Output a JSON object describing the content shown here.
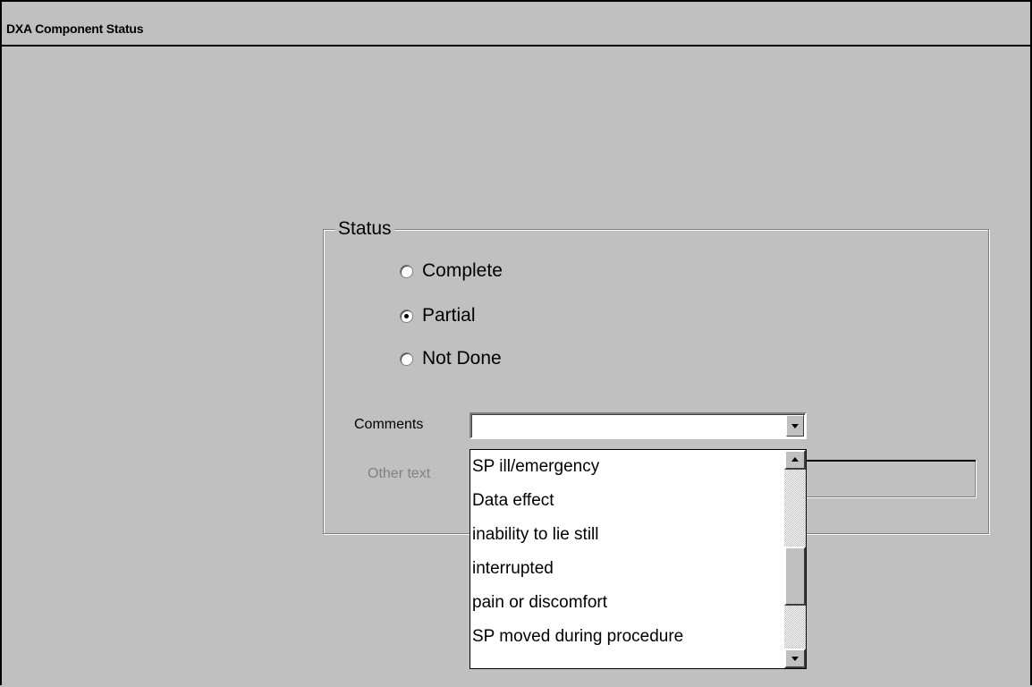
{
  "window": {
    "title": "DXA Component Status"
  },
  "status_group": {
    "legend": "Status",
    "options": [
      {
        "label": "Complete",
        "checked": false
      },
      {
        "label": "Partial",
        "checked": true
      },
      {
        "label": "Not Done",
        "checked": false
      }
    ]
  },
  "comments": {
    "label": "Comments",
    "value": "",
    "items": [
      "SP ill/emergency",
      "Data effect",
      "inability to lie still",
      "interrupted",
      "pain or discomfort",
      "SP moved during procedure"
    ]
  },
  "other_text": {
    "label": "Other text",
    "value": ""
  },
  "colors": {
    "background": "#c0c0c0",
    "list_background": "#ffffff",
    "disabled_text": "#808080"
  },
  "icons": {
    "combo_button": "chevron-down-icon",
    "scroll_up": "arrow-up-icon",
    "scroll_down": "arrow-down-icon"
  }
}
